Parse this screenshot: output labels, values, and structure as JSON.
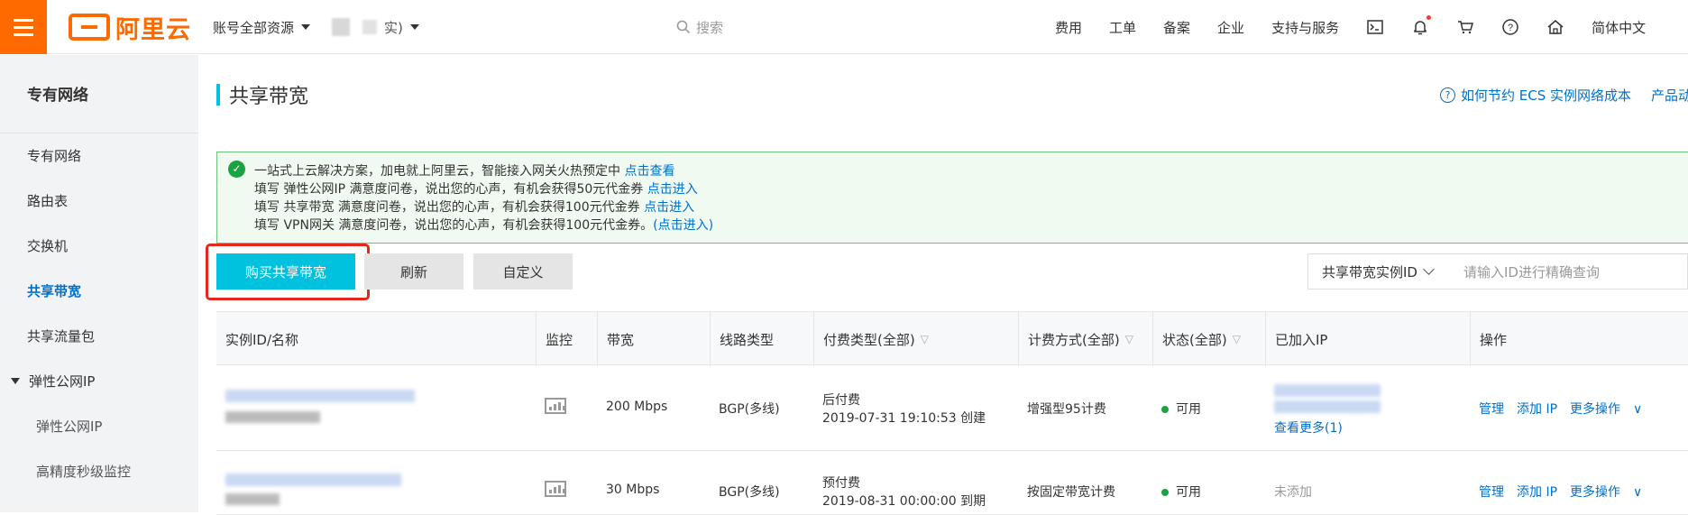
{
  "topbar": {
    "logo_text": "阿里云",
    "account_label": "账号全部资源",
    "org_suffix": "实)",
    "search_placeholder": "搜索",
    "nav": [
      "费用",
      "工单",
      "备案",
      "企业",
      "支持与服务"
    ],
    "icons": [
      "terminal-icon",
      "bell-icon",
      "cart-icon",
      "help-icon",
      "home-icon"
    ],
    "language": "简体中文"
  },
  "sidebar": {
    "title": "专有网络",
    "items": [
      "专有网络",
      "路由表",
      "交换机",
      "共享带宽",
      "共享流量包"
    ],
    "group": "弹性公网IP",
    "sub_items": [
      "弹性公网IP",
      "高精度秒级监控"
    ],
    "active": "共享带宽"
  },
  "page": {
    "title": "共享带宽",
    "help_link": "如何节约 ECS 实例网络成本",
    "product_link": "产品动"
  },
  "notice": {
    "lines": [
      {
        "text": "一站式上云解决方案，加电就上阿里云，智能接入网关火热预定中 ",
        "link": "点击查看"
      },
      {
        "text": "填写 弹性公网IP 满意度问卷，说出您的心声，有机会获得50元代金券 ",
        "link": "点击进入"
      },
      {
        "text": "填写 共享带宽 满意度问卷，说出您的心声，有机会获得100元代金券 ",
        "link": "点击进入"
      },
      {
        "text": "填写 VPN网关 满意度问卷，说出您的心声，有机会获得100元代金券。",
        "link": "(点击进入)"
      }
    ]
  },
  "toolbar": {
    "buy_label": "购买共享带宽",
    "refresh_label": "刷新",
    "custom_label": "自定义",
    "filter_select": "共享带宽实例ID",
    "search_placeholder": "请输入ID进行精确查询"
  },
  "table": {
    "headers": [
      "实例ID/名称",
      "监控",
      "带宽",
      "线路类型",
      "付费类型(全部)",
      "计费方式(全部)",
      "状态(全部)",
      "已加入IP",
      "操作"
    ],
    "rows": [
      {
        "bandwidth": "200 Mbps",
        "line": "BGP(多线)",
        "pay_type": "后付费",
        "pay_time": "2019-07-31 19:10:53 创建",
        "billing": "增强型95计费",
        "status": "可用",
        "ips_more": "查看更多(1)",
        "ops": [
          "管理",
          "添加 IP",
          "更多操作"
        ]
      },
      {
        "bandwidth": "30 Mbps",
        "line": "BGP(多线)",
        "pay_type": "预付费",
        "pay_time": "2019-08-31 00:00:00 到期",
        "billing": "按固定带宽计费",
        "status": "可用",
        "ips": "未添加",
        "ops": [
          "管理",
          "添加 IP",
          "更多操作"
        ]
      }
    ]
  },
  "colors": {
    "brand": "#ff6a00",
    "primary": "#00c1de",
    "link": "#0070cc",
    "success": "#1ba341",
    "highlight": "#e3271a"
  }
}
